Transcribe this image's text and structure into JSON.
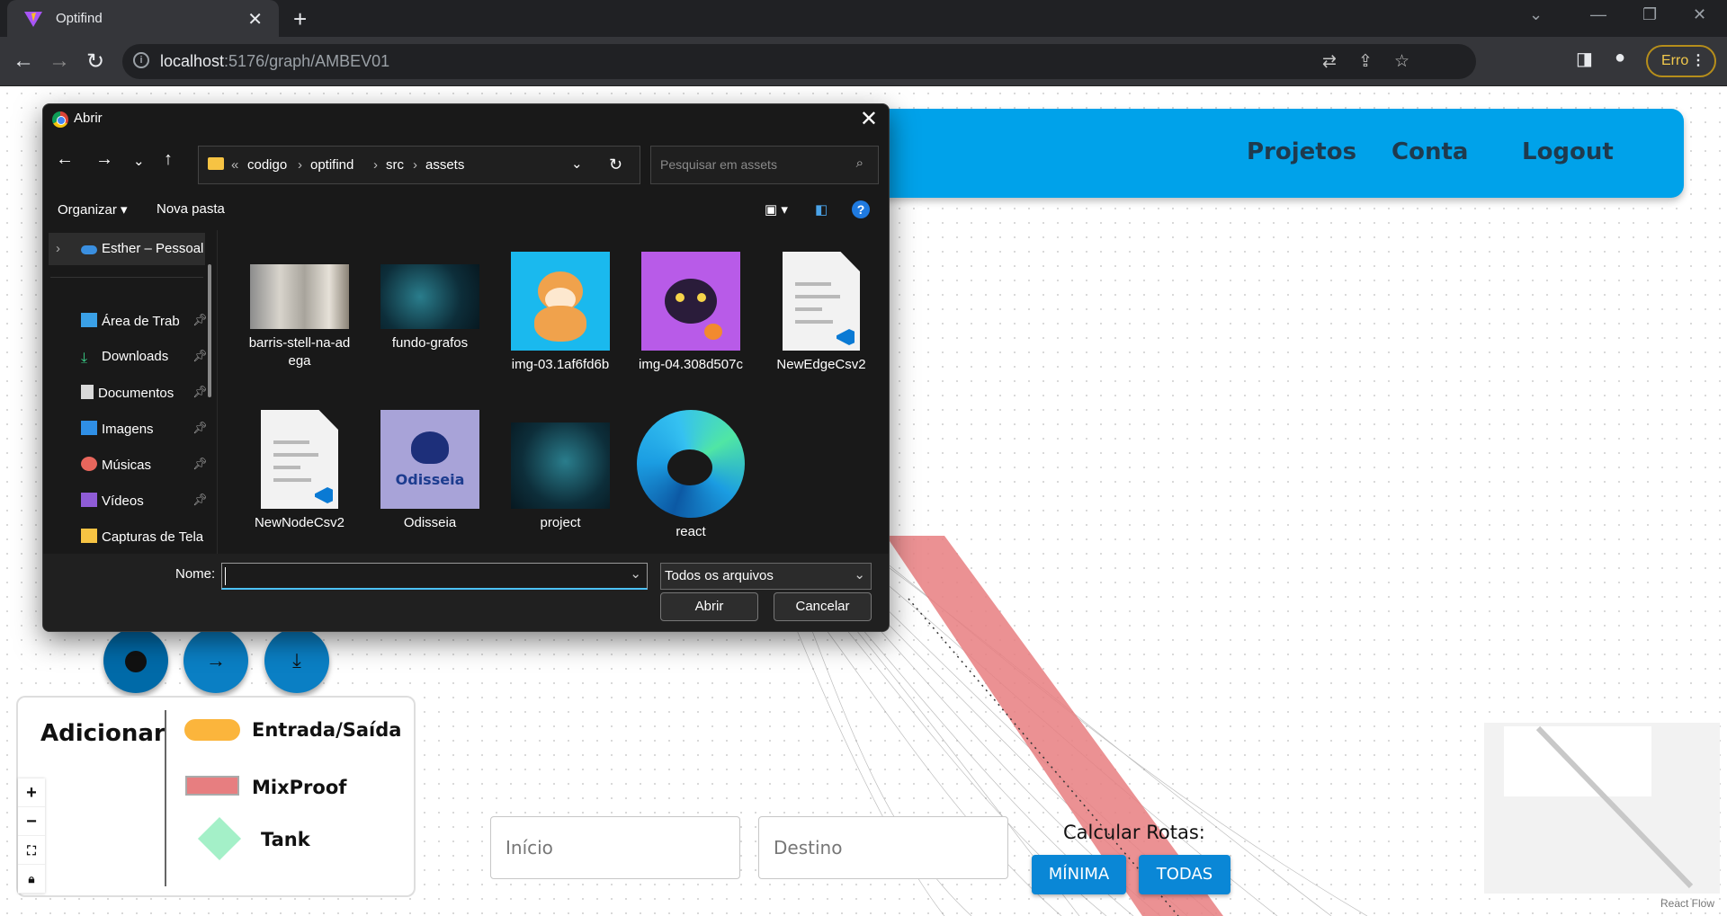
{
  "browser": {
    "tab_title": "Optifind",
    "tab_close": "✕",
    "new_tab": "+",
    "url_host": "localhost",
    "url_path": ":5176/graph/AMBEV01",
    "profile_badge": "Erro"
  },
  "app": {
    "nav": [
      "Projetos",
      "Conta",
      "Logout"
    ],
    "legend": {
      "add_label": "Adicionar",
      "items": [
        "Entrada/Saída",
        "MixProof",
        "Tank"
      ]
    },
    "inputs": {
      "inicio_placeholder": "Início",
      "destino_placeholder": "Destino"
    },
    "calc_label": "Calcular Rotas:",
    "calc_buttons": [
      "MÍNIMA",
      "TODAS"
    ],
    "attribution": "React Flow",
    "colors": {
      "nav_bg": "#00a2ea",
      "entrada": "#fbb53c",
      "mixproof": "#e77e80",
      "tank": "#a4f0c8",
      "button": "#0a87d6"
    }
  },
  "dialog": {
    "title": "Abrir",
    "breadcrumb": [
      "codigo",
      "optifind",
      "src",
      "assets"
    ],
    "search_placeholder": "Pesquisar em assets",
    "organize": "Organizar",
    "new_folder": "Nova pasta",
    "help": "?",
    "nav_items": [
      {
        "label": "Esther – Pessoal",
        "icon": "onedrive-icon"
      },
      {
        "label": "Área de Trab",
        "icon": "desktop-icon",
        "pinned": true
      },
      {
        "label": "Downloads",
        "icon": "download-icon",
        "pinned": true
      },
      {
        "label": "Documentos",
        "icon": "documents-icon",
        "pinned": true
      },
      {
        "label": "Imagens",
        "icon": "pictures-icon",
        "pinned": true
      },
      {
        "label": "Músicas",
        "icon": "music-icon",
        "pinned": true
      },
      {
        "label": "Vídeos",
        "icon": "videos-icon",
        "pinned": true
      },
      {
        "label": "Capturas de Tela",
        "icon": "folder-icon"
      }
    ],
    "files": [
      {
        "name": "barris-stell-na-adega",
        "label_lines": [
          "barris-stell-na-ad",
          "ega"
        ],
        "kind": "photo"
      },
      {
        "name": "fundo-grafos",
        "kind": "graph-image"
      },
      {
        "name": "img-03.1af6fd6b",
        "kind": "dog-image"
      },
      {
        "name": "img-04.308d507c",
        "kind": "cat-image"
      },
      {
        "name": "NewEdgeCsv2",
        "kind": "vscode-file"
      },
      {
        "name": "NewNodeCsv2",
        "kind": "vscode-file"
      },
      {
        "name": "Odisseia",
        "kind": "logo-image",
        "logo_text": "Odisseia"
      },
      {
        "name": "project",
        "kind": "graph-image"
      },
      {
        "name": "react",
        "kind": "edge-logo"
      }
    ],
    "filename_label": "Nome:",
    "filename_value": "",
    "filter_value": "Todos os arquivos",
    "open_button": "Abrir",
    "cancel_button": "Cancelar"
  }
}
